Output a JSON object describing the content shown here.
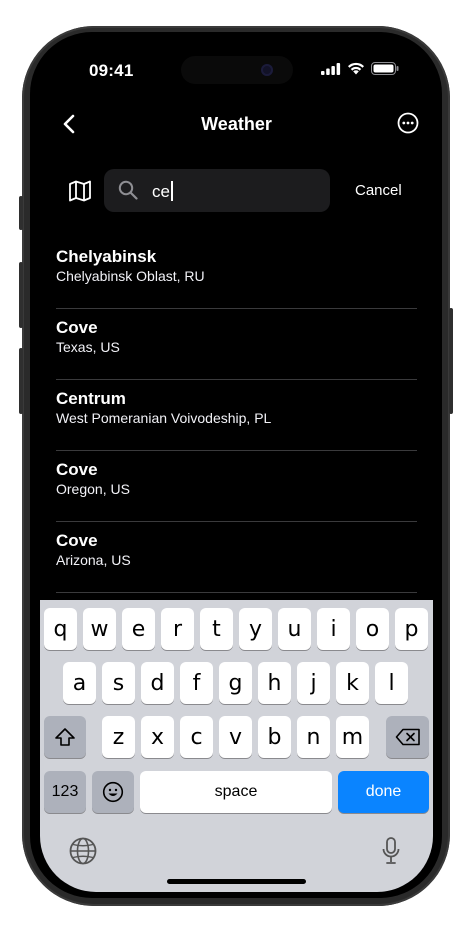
{
  "status": {
    "time": "09:41"
  },
  "nav": {
    "title": "Weather"
  },
  "search": {
    "value": "ce",
    "cancel_label": "Cancel"
  },
  "results": [
    {
      "name": "Chelyabinsk",
      "region": "Chelyabinsk Oblast, RU"
    },
    {
      "name": "Cove",
      "region": "Texas, US"
    },
    {
      "name": "Centrum",
      "region": "West Pomeranian Voivodeship, PL"
    },
    {
      "name": "Cove",
      "region": "Oregon, US"
    },
    {
      "name": "Cove",
      "region": "Arizona, US"
    }
  ],
  "keyboard": {
    "row1": [
      "q",
      "w",
      "e",
      "r",
      "t",
      "y",
      "u",
      "i",
      "o",
      "p"
    ],
    "row2": [
      "a",
      "s",
      "d",
      "f",
      "g",
      "h",
      "j",
      "k",
      "l"
    ],
    "row3": [
      "z",
      "x",
      "c",
      "v",
      "b",
      "n",
      "m"
    ],
    "numbers_label": "123",
    "space_label": "space",
    "done_label": "done"
  },
  "colors": {
    "accent": "#0a84ff",
    "background": "#000000",
    "keyboard": "#d1d3d9"
  }
}
